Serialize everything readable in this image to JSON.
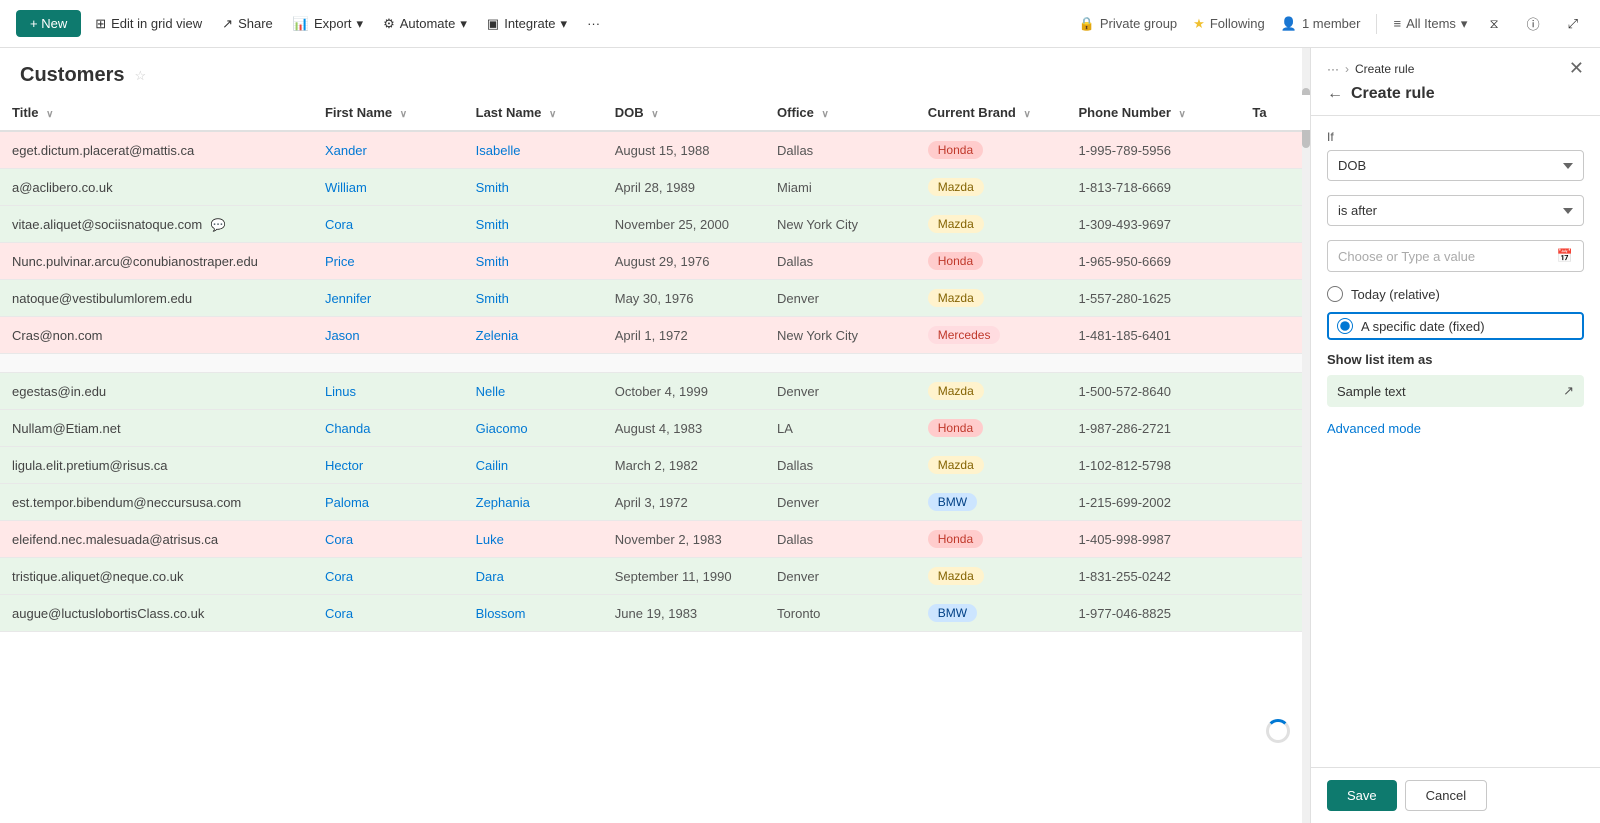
{
  "topBar": {
    "newLabel": "+ New",
    "editGridLabel": "Edit in grid view",
    "shareLabel": "Share",
    "exportLabel": "Export",
    "automateLabel": "Automate",
    "integrateLabel": "Integrate",
    "moreLabel": "···",
    "privateGroup": "Private group",
    "following": "Following",
    "member": "1 member",
    "allItems": "All Items"
  },
  "page": {
    "title": "Customers"
  },
  "table": {
    "columns": [
      "Title",
      "First Name",
      "Last Name",
      "DOB",
      "Office",
      "Current Brand",
      "Phone Number",
      "Ta"
    ],
    "rows": [
      {
        "title": "eget.dictum.placerat@mattis.ca",
        "firstName": "Xander",
        "lastName": "Isabelle",
        "dob": "August 15, 1988",
        "office": "Dallas",
        "brand": "Honda",
        "brandClass": "badge-honda",
        "phone": "1-995-789-5956",
        "rowClass": "row-pink",
        "chat": false
      },
      {
        "title": "a@aclibero.co.uk",
        "firstName": "William",
        "lastName": "Smith",
        "dob": "April 28, 1989",
        "office": "Miami",
        "brand": "Mazda",
        "brandClass": "badge-mazda",
        "phone": "1-813-718-6669",
        "rowClass": "row-green",
        "chat": false
      },
      {
        "title": "vitae.aliquet@sociisnatoque.com",
        "firstName": "Cora",
        "lastName": "Smith",
        "dob": "November 25, 2000",
        "office": "New York City",
        "brand": "Mazda",
        "brandClass": "badge-mazda",
        "phone": "1-309-493-9697",
        "rowClass": "row-green",
        "chat": true
      },
      {
        "title": "Nunc.pulvinar.arcu@conubianostraper.edu",
        "firstName": "Price",
        "lastName": "Smith",
        "dob": "August 29, 1976",
        "office": "Dallas",
        "brand": "Honda",
        "brandClass": "badge-honda",
        "phone": "1-965-950-6669",
        "rowClass": "row-pink",
        "chat": false
      },
      {
        "title": "natoque@vestibulumlorem.edu",
        "firstName": "Jennifer",
        "lastName": "Smith",
        "dob": "May 30, 1976",
        "office": "Denver",
        "brand": "Mazda",
        "brandClass": "badge-mazda",
        "phone": "1-557-280-1625",
        "rowClass": "row-green",
        "chat": false
      },
      {
        "title": "Cras@non.com",
        "firstName": "Jason",
        "lastName": "Zelenia",
        "dob": "April 1, 1972",
        "office": "New York City",
        "brand": "Mercedes",
        "brandClass": "badge-mercedes",
        "phone": "1-481-185-6401",
        "rowClass": "row-pink",
        "chat": false
      },
      {
        "title": "",
        "firstName": "",
        "lastName": "",
        "dob": "",
        "office": "",
        "brand": "",
        "brandClass": "",
        "phone": "",
        "rowClass": "row-empty",
        "chat": false
      },
      {
        "title": "egestas@in.edu",
        "firstName": "Linus",
        "lastName": "Nelle",
        "dob": "October 4, 1999",
        "office": "Denver",
        "brand": "Mazda",
        "brandClass": "badge-mazda",
        "phone": "1-500-572-8640",
        "rowClass": "row-green",
        "chat": false
      },
      {
        "title": "Nullam@Etiam.net",
        "firstName": "Chanda",
        "lastName": "Giacomo",
        "dob": "August 4, 1983",
        "office": "LA",
        "brand": "Honda",
        "brandClass": "badge-honda",
        "phone": "1-987-286-2721",
        "rowClass": "row-green",
        "chat": false
      },
      {
        "title": "ligula.elit.pretium@risus.ca",
        "firstName": "Hector",
        "lastName": "Cailin",
        "dob": "March 2, 1982",
        "office": "Dallas",
        "brand": "Mazda",
        "brandClass": "badge-mazda",
        "phone": "1-102-812-5798",
        "rowClass": "row-green",
        "chat": false
      },
      {
        "title": "est.tempor.bibendum@neccursusa.com",
        "firstName": "Paloma",
        "lastName": "Zephania",
        "dob": "April 3, 1972",
        "office": "Denver",
        "brand": "BMW",
        "brandClass": "badge-bmw",
        "phone": "1-215-699-2002",
        "rowClass": "row-green",
        "chat": false
      },
      {
        "title": "eleifend.nec.malesuada@atrisus.ca",
        "firstName": "Cora",
        "lastName": "Luke",
        "dob": "November 2, 1983",
        "office": "Dallas",
        "brand": "Honda",
        "brandClass": "badge-honda",
        "phone": "1-405-998-9987",
        "rowClass": "row-pink",
        "chat": false
      },
      {
        "title": "tristique.aliquet@neque.co.uk",
        "firstName": "Cora",
        "lastName": "Dara",
        "dob": "September 11, 1990",
        "office": "Denver",
        "brand": "Mazda",
        "brandClass": "badge-mazda",
        "phone": "1-831-255-0242",
        "rowClass": "row-green",
        "chat": false
      },
      {
        "title": "augue@luctuslobortisClass.co.uk",
        "firstName": "Cora",
        "lastName": "Blossom",
        "dob": "June 19, 1983",
        "office": "Toronto",
        "brand": "BMW",
        "brandClass": "badge-bmw",
        "phone": "1-977-046-8825",
        "rowClass": "row-green",
        "chat": false
      }
    ]
  },
  "panel": {
    "breadcrumbDots": "···",
    "breadcrumbSep": ">",
    "breadcrumbCurrent": "Create rule",
    "title": "Create rule",
    "ifLabel": "If",
    "fieldSelect": "DOB",
    "operatorSelect": "is after",
    "valuePlaceholder": "Choose or Type a value",
    "radioOptions": [
      {
        "label": "Today (relative)",
        "selected": false
      },
      {
        "label": "A specific date (fixed)",
        "selected": true
      }
    ],
    "showListAs": "Show list item as",
    "sampleText": "Sample text",
    "advancedMode": "Advanced mode",
    "saveLabel": "Save",
    "cancelLabel": "Cancel"
  }
}
